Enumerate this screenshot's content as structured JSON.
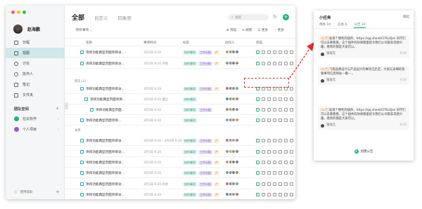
{
  "sidebar": {
    "user": "赵海鹏",
    "items": [
      {
        "label": "日程"
      },
      {
        "label": "视图"
      },
      {
        "label": "讨论"
      },
      {
        "label": "协作人"
      },
      {
        "label": "笔记"
      },
      {
        "label": "文件夹"
      }
    ],
    "team_title": "团队空间",
    "spaces": [
      {
        "label": "在云协作"
      },
      {
        "label": "个人项目"
      }
    ],
    "help": "使用帮助"
  },
  "main": {
    "tabs": [
      {
        "label": "全部"
      },
      {
        "label": "自定义"
      },
      {
        "label": "四象限"
      }
    ],
    "search_placeholder": "搜索",
    "filter": "所有事项 ⌄",
    "tools": [
      "⊕ 筛选",
      "↻ 刷新",
      "☰ 更多",
      "⋯ 更多"
    ],
    "columns": {
      "name": "名称",
      "time": "事项时间",
      "tag": "标签",
      "people": "协作人",
      "progress": "完成"
    },
    "groups": [
      "今天 (4) 星期三",
      "明天 (2)",
      "本周"
    ],
    "rows": [
      {
        "title": "项目功能典型页面项目访...",
        "date": "3月3日 9:20"
      },
      {
        "title": "项目功能典型页面项目访...",
        "date": "3月3日 9:20 开始"
      },
      {
        "title": "项目功能典型页面项目访...",
        "date": "3月3日 9:20"
      },
      {
        "title": "项目功能典型页面项目...",
        "date": "3月3日 9:20 截止"
      },
      {
        "title": "项目功能典型页面...",
        "date": "3月3日 9:20"
      },
      {
        "title": "项目功能典型页面项目...",
        "date": "3月3日 9:20"
      },
      {
        "title": "项目功能典型页面项目访...",
        "date": "3月3日 9:20 - 4月3日 9:20"
      },
      {
        "title": "项目功能典型页面项目访...",
        "date": "3月3日 9:20"
      },
      {
        "title": "项目功能典型页面项目访...",
        "date": "3月3日 9:20"
      },
      {
        "title": "项目功能典型页面项目访...",
        "date": "3月3日 9:20"
      },
      {
        "title": "项目功能典型页面项目访...",
        "date": "3月3日 9:20 开始"
      },
      {
        "title": "项目功能典型页面项目访...",
        "date": "3月3日 9:20"
      }
    ],
    "tags": {
      "a": "协作事项",
      "b": "工作分配",
      "c": "产"
    },
    "note": "添加协作人"
  },
  "popup": {
    "title": "小任务",
    "close": "收起",
    "tabs": [
      {
        "label": "待办 10"
      },
      {
        "label": "已办 6"
      },
      {
        "label": "公告 10"
      }
    ],
    "cards": [
      {
        "org": "[公告]",
        "text": "发现个便利的插件。https://qq.sheet/CFRL4Jxn 同学们可以去看看看。这个插件的效果看着挺令我们公司都非常感兴趣，看到的都是大家可以。",
        "author": "张海元",
        "time": "9:30"
      },
      {
        "org": "[公告]",
        "text": "飞现品牌设计与产品设计的事项已启定。大家先详细的查看事项信息网站一番一⌄",
        "author": "张海元",
        "time": "9:30"
      },
      {
        "org": "[公告]",
        "text": "发现个便利的插件。https://qq.sheet/CFRL4Jxn 同学们可以去看看看。这个插件的效果看着挺令我们公司都非常感兴趣，看到的都是大家可以。",
        "author": "张海元",
        "time": "9:30"
      }
    ],
    "footer": "创建公告"
  },
  "colors": {
    "accent": "#20b57d",
    "teal": "#1ab0a0",
    "red": "#e0302e"
  }
}
